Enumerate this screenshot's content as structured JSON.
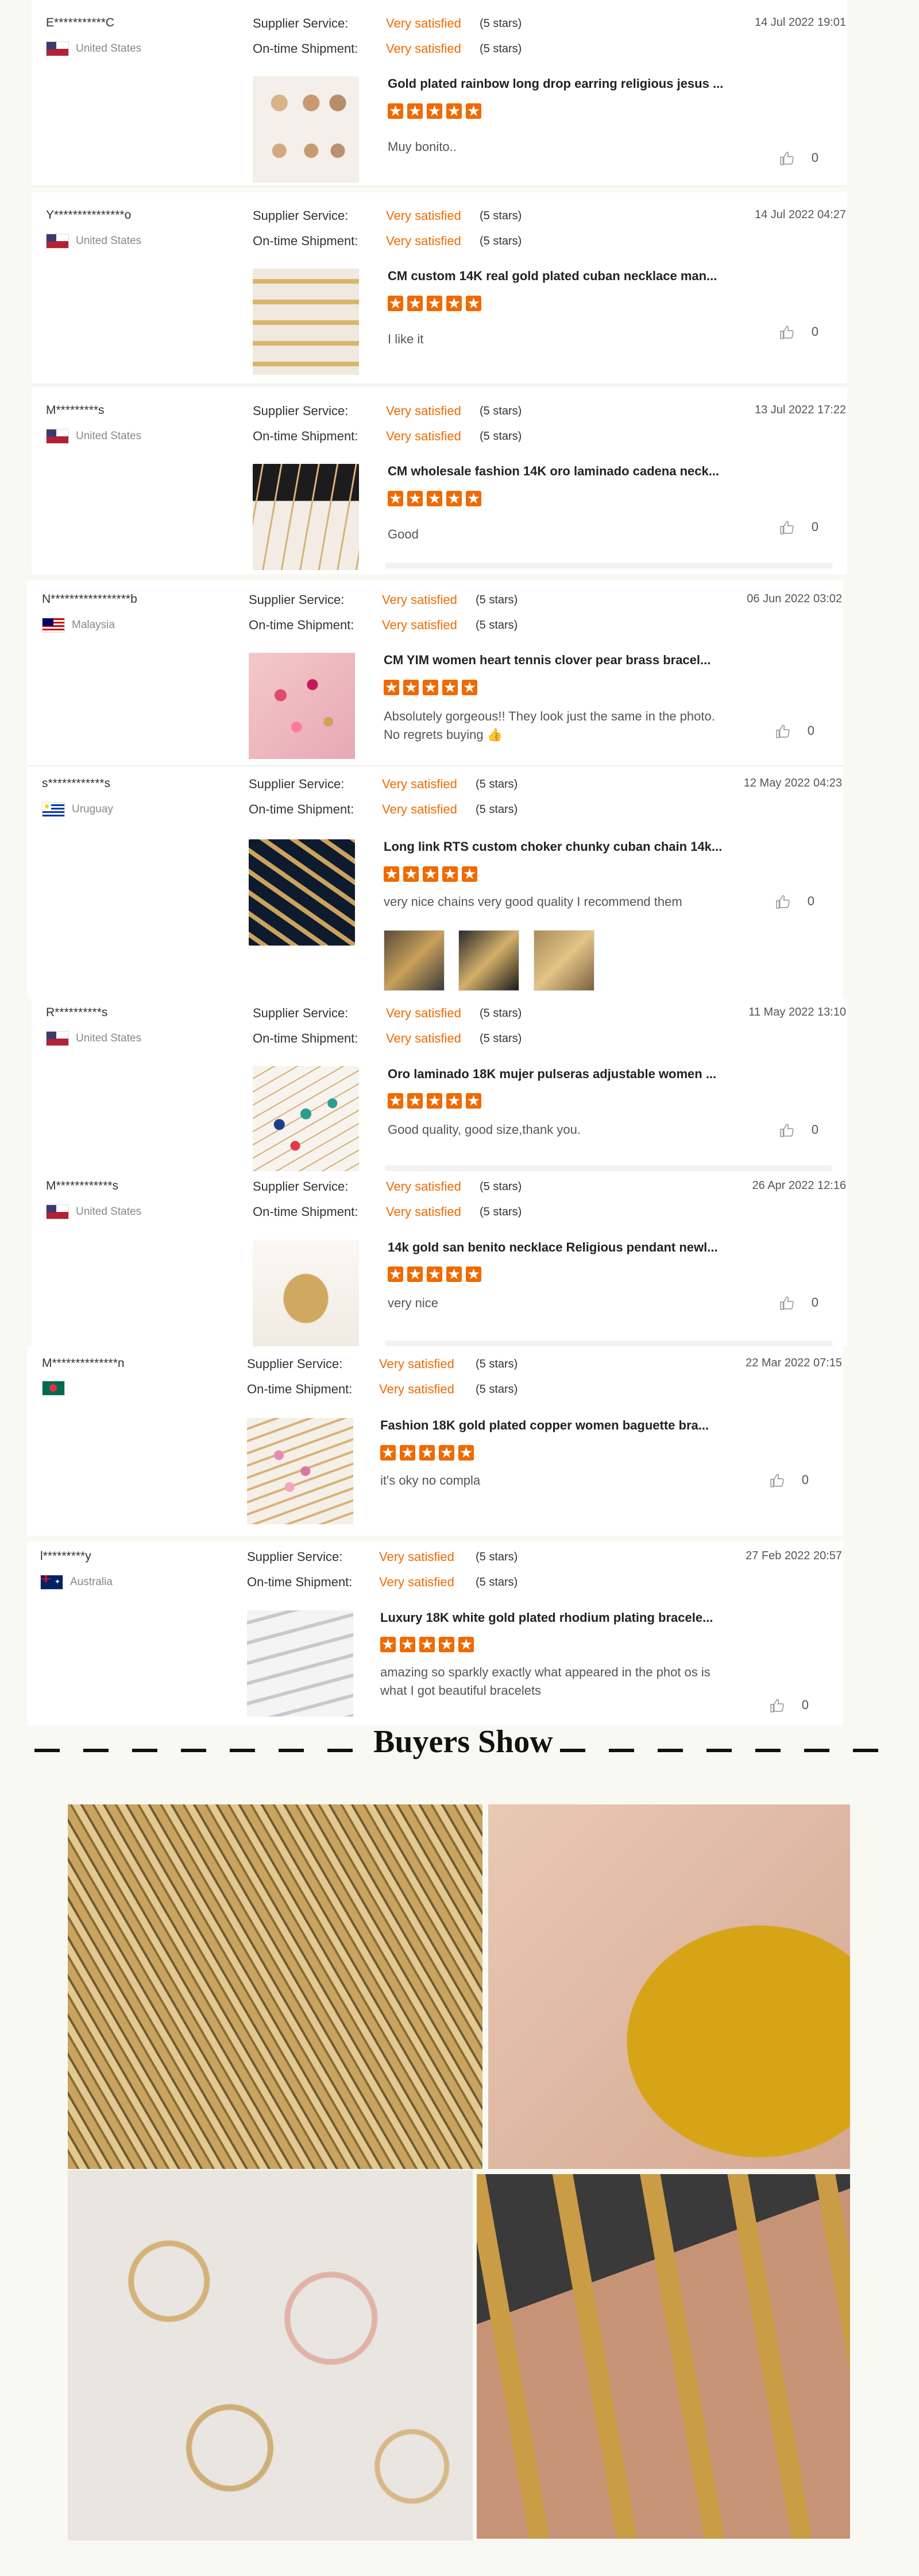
{
  "labels": {
    "supplier_service": "Supplier Service:",
    "ontime_shipment": "On-time Shipment:"
  },
  "reviews": [
    {
      "name": "E***********C",
      "country": "United States",
      "flag": "us",
      "supplier_rating": "Very satisfied",
      "supplier_stars": "(5 stars)",
      "shipment_rating": "Very satisfied",
      "shipment_stars": "(5 stars)",
      "date": "14 Jul 2022 19:01",
      "product_title": "Gold plated rainbow long drop earring religious jesus ...",
      "text": "Muy bonito..",
      "likes": "0"
    },
    {
      "name": "Y***************o",
      "country": "United States",
      "flag": "us",
      "supplier_rating": "Very satisfied",
      "supplier_stars": "(5 stars)",
      "shipment_rating": "Very satisfied",
      "shipment_stars": "(5 stars)",
      "date": "14 Jul 2022 04:27",
      "product_title": "CM custom 14K real gold plated cuban necklace man...",
      "text": "I like it",
      "likes": "0"
    },
    {
      "name": "M*********s",
      "country": "United States",
      "flag": "us",
      "supplier_rating": "Very satisfied",
      "supplier_stars": "(5 stars)",
      "shipment_rating": "Very satisfied",
      "shipment_stars": "(5 stars)",
      "date": "13 Jul 2022 17:22",
      "product_title": "CM wholesale fashion 14K oro laminado cadena neck...",
      "text": "Good",
      "likes": "0"
    },
    {
      "name": "N*****************b",
      "country": "Malaysia",
      "flag": "my",
      "supplier_rating": "Very satisfied",
      "supplier_stars": "(5 stars)",
      "shipment_rating": "Very satisfied",
      "shipment_stars": "(5 stars)",
      "date": "06 Jun 2022 03:02",
      "product_title": "CM YIM women heart tennis clover pear brass bracel...",
      "text": "Absolutely gorgeous!! They look just the same in the photo. No regrets buying 👍",
      "likes": "0"
    },
    {
      "name": "s************s",
      "country": "Uruguay",
      "flag": "uy",
      "supplier_rating": "Very satisfied",
      "supplier_stars": "(5 stars)",
      "shipment_rating": "Very satisfied",
      "shipment_stars": "(5 stars)",
      "date": "12 May 2022 04:23",
      "product_title": "Long link RTS custom choker chunky cuban chain 14k...",
      "text": "very nice chains very good quality I recommend them",
      "likes": "0"
    },
    {
      "name": "R**********s",
      "country": "United States",
      "flag": "us",
      "supplier_rating": "Very satisfied",
      "supplier_stars": "(5 stars)",
      "shipment_rating": "Very satisfied",
      "shipment_stars": "(5 stars)",
      "date": "11 May 2022 13:10",
      "product_title": "Oro laminado 18K mujer pulseras adjustable women ...",
      "text": "Good quality, good size,thank you.",
      "likes": "0"
    },
    {
      "name": "M************s",
      "country": "United States",
      "flag": "us",
      "supplier_rating": "Very satisfied",
      "supplier_stars": "(5 stars)",
      "shipment_rating": "Very satisfied",
      "shipment_stars": "(5 stars)",
      "date": "26 Apr 2022 12:16",
      "product_title": "14k gold san benito necklace Religious pendant newl...",
      "text": "very nice",
      "likes": "0"
    },
    {
      "name": "M**************n",
      "country": "",
      "flag": "bd",
      "supplier_rating": "Very satisfied",
      "supplier_stars": "(5 stars)",
      "shipment_rating": "Very satisfied",
      "shipment_stars": "(5 stars)",
      "date": "22 Mar 2022 07:15",
      "product_title": "Fashion 18K gold plated copper women baguette bra...",
      "text": "it's oky no compla",
      "likes": "0"
    },
    {
      "name": "l*********y",
      "country": "Australia",
      "flag": "au",
      "supplier_rating": "Very satisfied",
      "supplier_stars": "(5 stars)",
      "shipment_rating": "Very satisfied",
      "shipment_stars": "(5 stars)",
      "date": "27 Feb 2022 20:57",
      "product_title": "Luxury 18K white gold plated rhodium plating bracele...",
      "text": "amazing so sparkly exactly what appeared in the phot os is what I got beautiful bracelets",
      "likes": "0"
    }
  ],
  "buyers_show": {
    "title": "Buyers Show"
  },
  "colors": {
    "accent": "#f06a00",
    "page_bg": "#f9f9f4"
  }
}
